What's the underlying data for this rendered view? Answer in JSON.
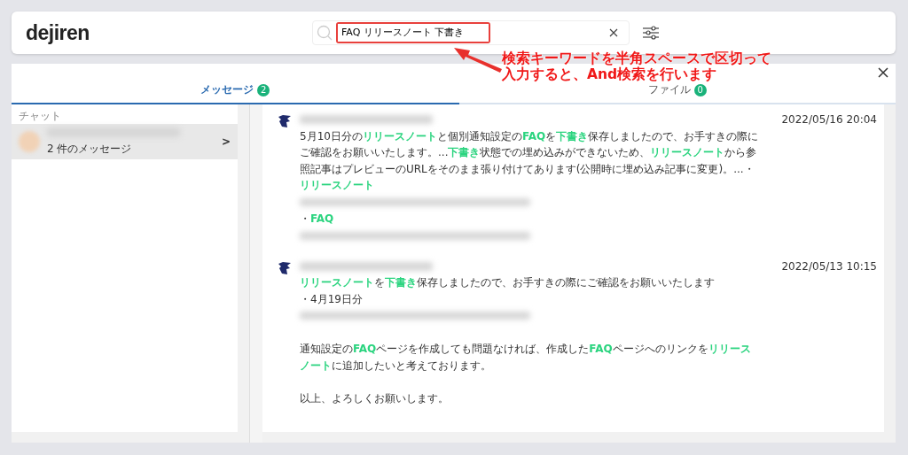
{
  "header": {
    "logo": "dejiren",
    "search": {
      "value": "FAQ リリースノート 下書き"
    }
  },
  "tabs": [
    {
      "label": "メッセージ",
      "count": "2",
      "selected": true
    },
    {
      "label": "ファイル",
      "count": "0",
      "selected": false
    }
  ],
  "sidebar": {
    "heading": "チャット",
    "items": [
      {
        "subtitle": "2 件のメッセージ",
        "chevron": ">",
        "selected": true
      }
    ]
  },
  "messages": [
    {
      "time": "2022/05/16 20:04",
      "blocks": [
        {
          "kind": "text",
          "text": "5月10日分の**リリースノート**と個別通知設定の**FAQ**を**下書き**保存しましたので、お手すきの際にご確認をお願いいたします。...**下書き**状態での埋め込みができないため、**リリースノート**から参照記事はプレビューのURLをそのまま張り付けてあります(公開時に埋め込み記事に変更)。...・**リリースノート**"
        },
        {
          "kind": "redacted"
        },
        {
          "kind": "text",
          "text": "・**FAQ**"
        },
        {
          "kind": "redacted"
        }
      ]
    },
    {
      "time": "2022/05/13 10:15",
      "blocks": [
        {
          "kind": "text",
          "text": "**リリースノート**を**下書き**保存しましたので、お手すきの際にご確認をお願いいたします"
        },
        {
          "kind": "text",
          "text": "・4月19日分"
        },
        {
          "kind": "redacted"
        },
        {
          "kind": "blank_line"
        },
        {
          "kind": "text",
          "text": "通知設定の**FAQ**ページを作成しても問題なければ、作成した**FAQ**ページへのリンクを**リリースノート**に追加したいと考えております。"
        },
        {
          "kind": "blank_line"
        },
        {
          "kind": "text",
          "text": "以上、よろしくお願いします。"
        }
      ]
    }
  ],
  "annotation": {
    "lines": [
      "検索キーワードを半角スペースで区切って",
      "入力すると、And検索を行います"
    ]
  }
}
